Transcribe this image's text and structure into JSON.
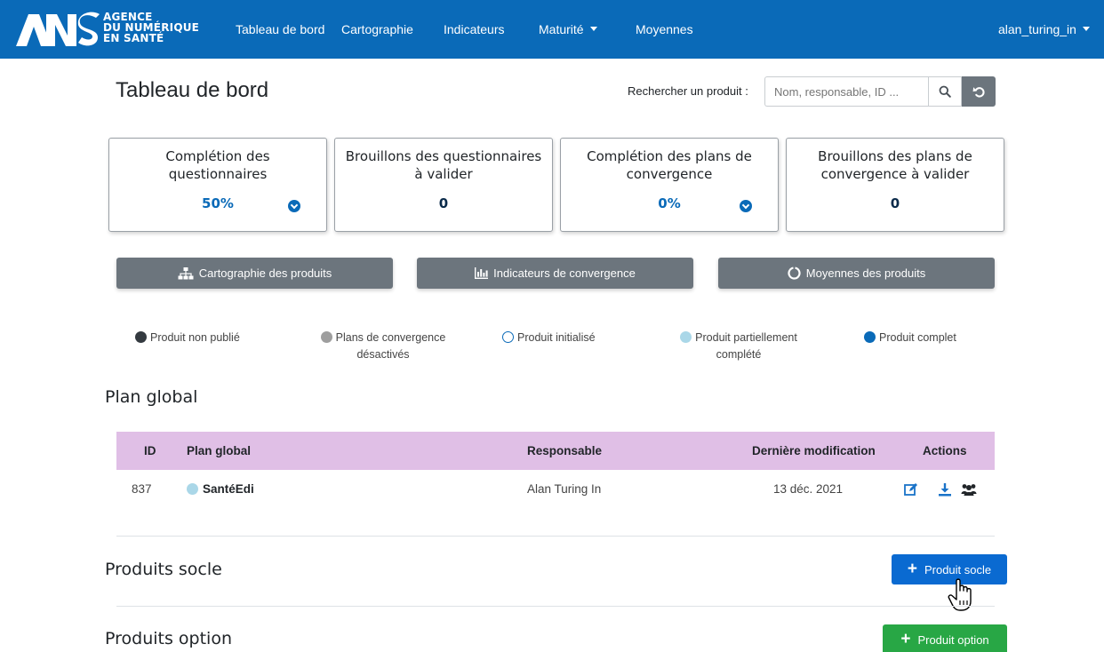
{
  "navbar": {
    "brand_lines": [
      "AGENCE",
      "DU NUMÉRIQUE",
      "EN SANTÉ"
    ],
    "items": [
      {
        "label": "Tableau de bord"
      },
      {
        "label": "Cartographie"
      },
      {
        "label": "Indicateurs"
      },
      {
        "label": "Maturité",
        "dropdown": true
      },
      {
        "label": "Moyennes"
      }
    ],
    "user": "alan_turing_in"
  },
  "header": {
    "title": "Tableau de bord",
    "search_label": "Rechercher un produit :",
    "search_placeholder": "Nom, responsable, ID ..."
  },
  "cards": [
    {
      "title": "Complétion des questionnaires",
      "value": "50%",
      "expandable": true
    },
    {
      "title": "Brouillons des questionnaires à valider",
      "value": "0",
      "expandable": false
    },
    {
      "title": "Complétion des plans de convergence",
      "value": "0%",
      "expandable": true
    },
    {
      "title": "Brouillons des plans de convergence à valider",
      "value": "0",
      "expandable": false
    }
  ],
  "actions": [
    {
      "label": "Cartographie des produits",
      "icon": "sitemap-icon"
    },
    {
      "label": "Indicateurs de convergence",
      "icon": "chart-area-icon"
    },
    {
      "label": "Moyennes des produits",
      "icon": "circle-notch-icon"
    }
  ],
  "legend": [
    {
      "label": "Produit non publié",
      "color": "#343a40"
    },
    {
      "label": "Plans de convergence désactivés",
      "color": "#9e9e9e"
    },
    {
      "label": "Produit initialisé",
      "color": "#ffffff"
    },
    {
      "label": "Produit partiellement complété",
      "color": "#aad7e8"
    },
    {
      "label": "Produit complet",
      "color": "#0a6ab8"
    }
  ],
  "plan_global": {
    "title": "Plan global",
    "columns": [
      "ID",
      "Plan global",
      "Responsable",
      "Dernière modification",
      "Actions"
    ],
    "rows": [
      {
        "id": "837",
        "name": "SantéEdi",
        "responsable": "Alan Turing In",
        "date": "13 déc. 2021",
        "status_color": "#aad7e8"
      }
    ]
  },
  "produits_socle": {
    "title": "Produits socle",
    "add_label": "Produit socle"
  },
  "produits_option": {
    "title": "Produits option",
    "add_label": "Produit option"
  },
  "colors": {
    "primary": "#0a6ab8",
    "secondary": "#6c757d",
    "success": "#28a745",
    "table_header": "#e0bfe6"
  }
}
